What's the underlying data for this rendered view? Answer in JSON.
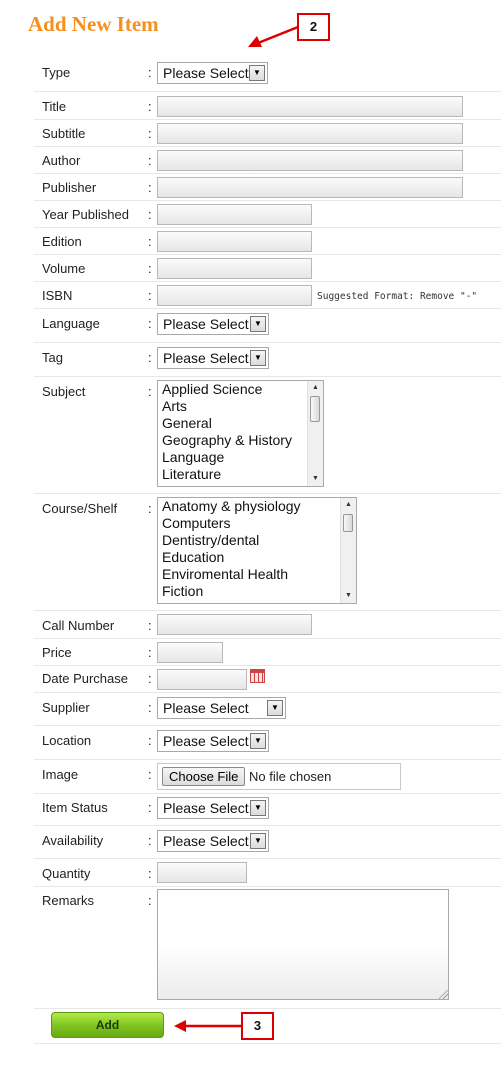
{
  "header": {
    "title": "Add New Item"
  },
  "colon": ":",
  "form": {
    "type": {
      "label": "Type",
      "value": "Please Select"
    },
    "title": {
      "label": "Title",
      "value": ""
    },
    "subtitle": {
      "label": "Subtitle",
      "value": ""
    },
    "author": {
      "label": "Author",
      "value": ""
    },
    "publisher": {
      "label": "Publisher",
      "value": ""
    },
    "year_published": {
      "label": "Year Published",
      "value": ""
    },
    "edition": {
      "label": "Edition",
      "value": ""
    },
    "volume": {
      "label": "Volume",
      "value": ""
    },
    "isbn": {
      "label": "ISBN",
      "value": "",
      "hint": "Suggested Format: Remove \"-\""
    },
    "language": {
      "label": "Language",
      "value": "Please Select"
    },
    "tag": {
      "label": "Tag",
      "value": "Please Select"
    },
    "subject": {
      "label": "Subject",
      "options": [
        "Applied Science",
        "Arts",
        "General",
        "Geography & History",
        "Language",
        "Literature"
      ]
    },
    "course_shelf": {
      "label": "Course/Shelf",
      "options": [
        "Anatomy & physiology",
        "Computers",
        "Dentistry/dental",
        "Education",
        "Enviromental Health",
        "Fiction"
      ]
    },
    "call_number": {
      "label": "Call Number",
      "value": ""
    },
    "price": {
      "label": "Price",
      "value": ""
    },
    "date_purchase": {
      "label": "Date Purchase",
      "value": "",
      "icon": "calendar-icon"
    },
    "supplier": {
      "label": "Supplier",
      "value": "Please Select"
    },
    "location": {
      "label": "Location",
      "value": "Please Select"
    },
    "image": {
      "label": "Image",
      "button": "Choose File",
      "status": "No file chosen"
    },
    "item_status": {
      "label": "Item Status",
      "value": "Please Select"
    },
    "availability": {
      "label": "Availability",
      "value": "Please Select"
    },
    "quantity": {
      "label": "Quantity",
      "value": ""
    },
    "remarks": {
      "label": "Remarks",
      "value": ""
    }
  },
  "actions": {
    "add_label": "Add"
  },
  "annotations": {
    "callout_2": "2",
    "callout_3": "3",
    "color": "#d00000"
  }
}
